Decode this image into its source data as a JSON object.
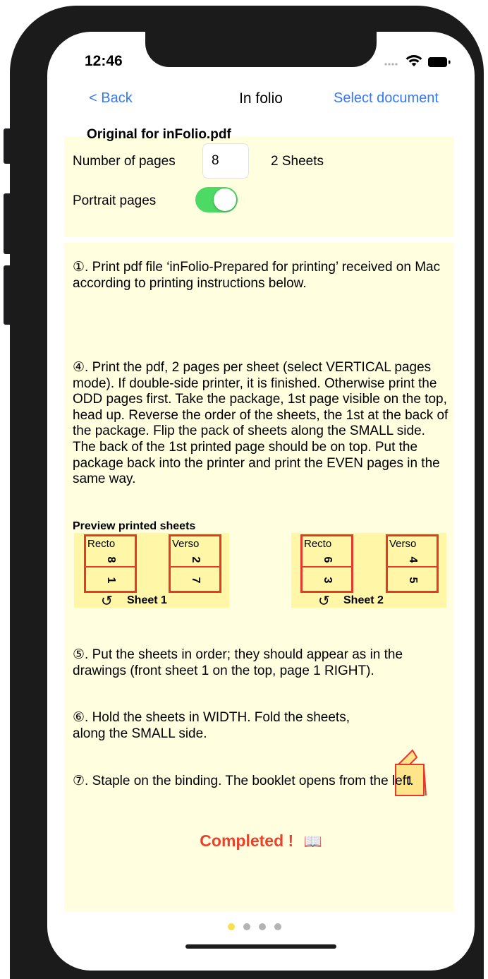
{
  "status_bar": {
    "time": "12:46"
  },
  "nav": {
    "back_label": "< Back",
    "title": "In folio",
    "select_label": "Select document"
  },
  "original": {
    "title": "Original for inFolio.pdf",
    "pages_label": "Number of pages",
    "pages_value": "8",
    "sheets_text": "2 Sheets",
    "portrait_label": "Portrait pages",
    "portrait_on": true
  },
  "instructions": {
    "step1": "①. Print pdf file ‘inFolio-Prepared for printing’ received on Mac according to printing instructions below.",
    "step4": "④. Print the pdf, 2 pages per sheet (select VERTICAL pages mode). If double-side printer, it is finished. Otherwise print the ODD pages first. Take the package, 1st page visible on the top, head up. Reverse the order of the sheets, the 1st at the back of the package. Flip the pack of sheets along the SMALL side. The back of the 1st printed page should be on top. Put the package back into the printer and print the EVEN pages in the same way.",
    "step5": "⑤. Put the sheets in order; they should appear as in the drawings (front sheet 1 on the top, page 1 RIGHT).",
    "step6": "⑥. Hold the sheets in WIDTH. Fold the sheets, along the SMALL side.",
    "step7": "⑦. Staple on the binding. The booklet opens from the left."
  },
  "preview": {
    "title": "Preview printed sheets",
    "rotate_icon": "rotate-ccw-icon",
    "sheets": [
      {
        "label": "Sheet 1",
        "recto": {
          "label": "Recto",
          "top": "8",
          "bottom": "1"
        },
        "verso": {
          "label": "Verso",
          "top": "2",
          "bottom": "7"
        }
      },
      {
        "label": "Sheet 2",
        "recto": {
          "label": "Recto",
          "top": "6",
          "bottom": "3"
        },
        "verso": {
          "label": "Verso",
          "top": "4",
          "bottom": "5"
        }
      }
    ]
  },
  "booklet_icon": {
    "page_number": "1"
  },
  "completed": {
    "text": "Completed !",
    "emoji": "📖"
  },
  "page_indicator": {
    "count": 4,
    "active_index": 0
  },
  "colors": {
    "accent_blue": "#3478f6",
    "panel_yellow": "#ffffe0",
    "sheet_yellow": "#fff6a8",
    "page_red": "#e53a2b",
    "toggle_green": "#4cd964",
    "completed_red": "#e8432d"
  }
}
